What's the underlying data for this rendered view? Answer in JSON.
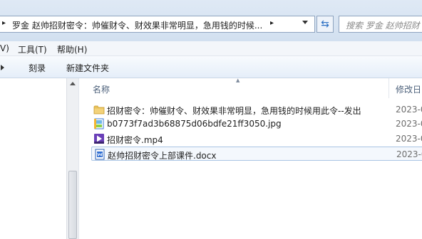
{
  "address_bar": {
    "path_text": "罗金 赵帅招财密令：帅催财令、财效果非常明显，急用钱的时候..."
  },
  "search": {
    "placeholder": "搜索 罗金 赵帅招财"
  },
  "menu": {
    "items": [
      "V)",
      "工具(T)",
      "帮助(H)"
    ]
  },
  "toolbar": {
    "burn_label": "刻录",
    "new_folder_label": "新建文件夹"
  },
  "columns": {
    "name": "名称",
    "modified": "修改日"
  },
  "files": [
    {
      "name": "招财密令：帅催财令、财效果非常明显，急用钱的时候用此令--发出",
      "date": "2023-0",
      "icon": "folder-icon"
    },
    {
      "name": "b0773f7ad3b68875d06bdfe21ff3050.jpg",
      "date": "2023-0",
      "icon": "image-file-icon"
    },
    {
      "name": "招财密令.mp4",
      "date": "2023-0",
      "icon": "video-file-icon"
    },
    {
      "name": "赵帅招财密令上部课件.docx",
      "date": "2023-0",
      "icon": "word-document-icon"
    }
  ],
  "colors": {
    "accent": "#2a6fc3",
    "selection_border": "#a9c4e4"
  }
}
